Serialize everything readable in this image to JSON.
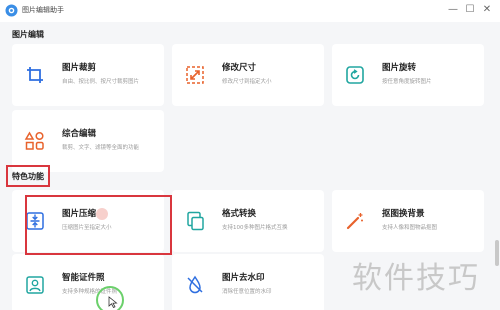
{
  "window": {
    "title": "图片编辑助手",
    "minimize_glyph": "—",
    "maximize_glyph": "☐",
    "close_glyph": "✕"
  },
  "sections": [
    {
      "title": "图片编辑"
    },
    {
      "title": "特色功能"
    }
  ],
  "cards": [
    {
      "title": "图片裁剪",
      "desc": "自由、按比例、按尺寸裁剪图片",
      "icon": "crop-icon",
      "color": "#2f6fe0"
    },
    {
      "title": "修改尺寸",
      "desc": "修改尺寸到指定大小",
      "icon": "resize-icon",
      "color": "#e8622c"
    },
    {
      "title": "图片旋转",
      "desc": "按任意角度旋转图片",
      "icon": "rotate-icon",
      "color": "#21a6a0"
    },
    {
      "title": "综合编辑",
      "desc": "裁剪、文字、滤镜等全面的功能",
      "icon": "shapes-icon",
      "color": "#e8622c"
    },
    {
      "title": "图片压缩",
      "desc": "压缩图片至指定大小",
      "icon": "compress-icon",
      "color": "#2f6fe0"
    },
    {
      "title": "格式转换",
      "desc": "支持100多种图片格式互换",
      "icon": "convert-icon",
      "color": "#21a6a0"
    },
    {
      "title": "抠图换背景",
      "desc": "支持人像和图物品抠图",
      "icon": "magic-wand-icon",
      "color": "#e8622c"
    },
    {
      "title": "智能证件照",
      "desc": "支持多种规格的证件照",
      "icon": "id-photo-icon",
      "color": "#21a6a0"
    },
    {
      "title": "图片去水印",
      "desc": "消除任意位置的水印",
      "icon": "watermark-remove-icon",
      "color": "#2f6fe0"
    }
  ],
  "watermark": "软件技巧",
  "accent_red": "#d9363e"
}
